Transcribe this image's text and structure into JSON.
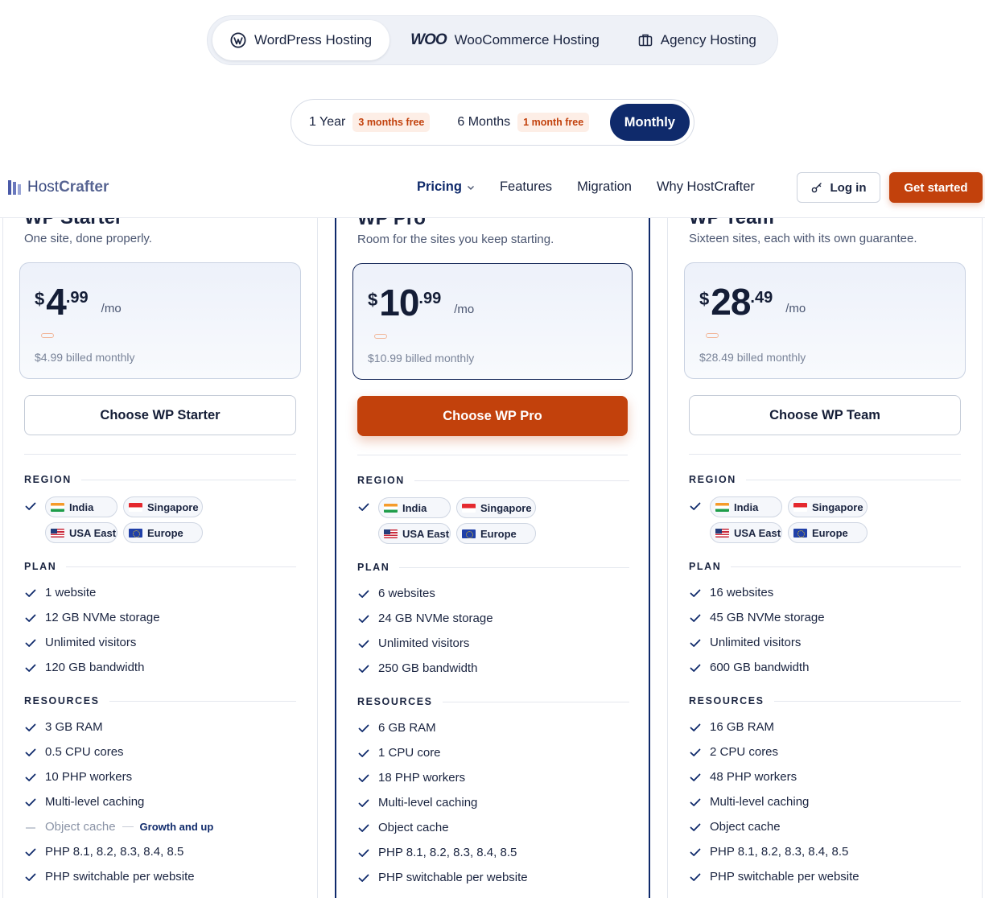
{
  "product_tabs": [
    {
      "label": "WordPress Hosting",
      "icon": "wordpress-icon",
      "active": true
    },
    {
      "label": "WooCommerce Hosting",
      "icon": "woo-icon",
      "mark": "WOO",
      "active": false
    },
    {
      "label": "Agency Hosting",
      "icon": "briefcase-icon",
      "active": false
    }
  ],
  "billing": [
    {
      "label": "1 Year",
      "badge": "3 months free"
    },
    {
      "label": "6 Months",
      "badge": "1 month free"
    },
    {
      "label": "Monthly",
      "badge": "",
      "active": true
    }
  ],
  "navbar": {
    "logo_host": "Host",
    "logo_crafter": "Crafter",
    "links": [
      "Pricing",
      "Features",
      "Migration",
      "Why HostCrafter"
    ],
    "login": "Log in",
    "get_started": "Get started"
  },
  "colors": {
    "accent": "#c2410c",
    "navy": "#0f2a6b",
    "text": "#1a2440"
  },
  "section_labels": {
    "region": "REGION",
    "plan": "PLAN",
    "resources": "RESOURCES"
  },
  "regions": [
    {
      "name": "India",
      "flag": "in"
    },
    {
      "name": "Singapore",
      "flag": "sg"
    },
    {
      "name": "USA East",
      "flag": "us"
    },
    {
      "name": "Europe",
      "flag": "eu"
    }
  ],
  "plans": [
    {
      "name": "WP Starter",
      "tagline": "One site, done properly.",
      "currency": "$",
      "price_int": "4",
      "price_dec": ".99",
      "per": "/mo",
      "billed": "$4.99 billed monthly",
      "cta": "Choose WP Starter",
      "plan_features": [
        "1 website",
        "12 GB NVMe storage",
        "Unlimited visitors",
        "120 GB bandwidth"
      ],
      "resources": [
        "3 GB RAM",
        "0.5 CPU cores",
        "10 PHP workers",
        "Multi-level caching",
        "Object cache",
        "PHP 8.1, 8.2, 8.3, 8.4, 8.5",
        "PHP switchable per website"
      ],
      "object_cache_note": "Growth and up"
    },
    {
      "name": "WP Pro",
      "tagline": "Room for the sites you keep starting.",
      "currency": "$",
      "price_int": "10",
      "price_dec": ".99",
      "per": "/mo",
      "billed": "$10.99 billed monthly",
      "cta": "Choose WP Pro",
      "plan_features": [
        "6 websites",
        "24 GB NVMe storage",
        "Unlimited visitors",
        "250 GB bandwidth"
      ],
      "resources": [
        "6 GB RAM",
        "1 CPU core",
        "18 PHP workers",
        "Multi-level caching",
        "Object cache",
        "PHP 8.1, 8.2, 8.3, 8.4, 8.5",
        "PHP switchable per website"
      ]
    },
    {
      "name": "WP Team",
      "tagline": "Sixteen sites, each with its own guarantee.",
      "currency": "$",
      "price_int": "28",
      "price_dec": ".49",
      "per": "/mo",
      "billed": "$28.49 billed monthly",
      "cta": "Choose WP Team",
      "plan_features": [
        "16 websites",
        "45 GB NVMe storage",
        "Unlimited visitors",
        "600 GB bandwidth"
      ],
      "resources": [
        "16 GB RAM",
        "2 CPU cores",
        "48 PHP workers",
        "Multi-level caching",
        "Object cache",
        "PHP 8.1, 8.2, 8.3, 8.4, 8.5",
        "PHP switchable per website"
      ]
    }
  ]
}
